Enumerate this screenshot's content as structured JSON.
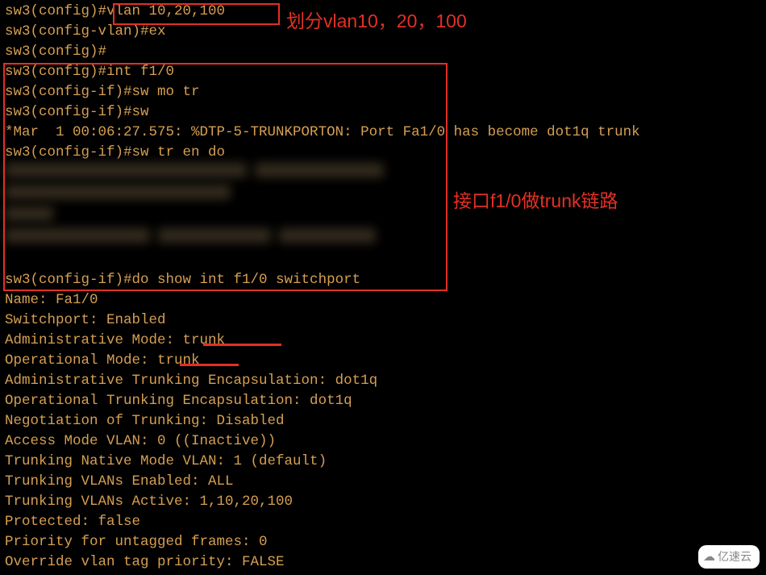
{
  "lines": {
    "l0": "sw3(config)#vlan 10,20,100",
    "l1": "sw3(config-vlan)#ex",
    "l2": "sw3(config)#",
    "l3": "sw3(config)#int f1/0",
    "l4": "sw3(config-if)#sw mo tr",
    "l5": "sw3(config-if)#sw",
    "l6": "*Mar  1 00:06:27.575: %DTP-5-TRUNKPORTON: Port Fa1/0 has become dot1q trunk",
    "l7": "sw3(config-if)#sw tr en do",
    "l13": "sw3(config-if)#do show int f1/0 switchport",
    "l14": "Name: Fa1/0",
    "l15": "Switchport: Enabled",
    "l16": "Administrative Mode: trunk",
    "l17": "Operational Mode: trunk",
    "l18": "Administrative Trunking Encapsulation: dot1q",
    "l19": "Operational Trunking Encapsulation: dot1q",
    "l20": "Negotiation of Trunking: Disabled",
    "l21": "Access Mode VLAN: 0 ((Inactive))",
    "l22": "Trunking Native Mode VLAN: 1 (default)",
    "l23": "Trunking VLANs Enabled: ALL",
    "l24": "Trunking VLANs Active: 1,10,20,100",
    "l25": "Protected: false",
    "l26": "Priority for untagged frames: 0",
    "l27": "Override vlan tag priority: FALSE"
  },
  "annotations": {
    "vlan": "划分vlan10，20，100",
    "trunk": "接口f1/0做trunk链路"
  },
  "watermark": "亿速云"
}
